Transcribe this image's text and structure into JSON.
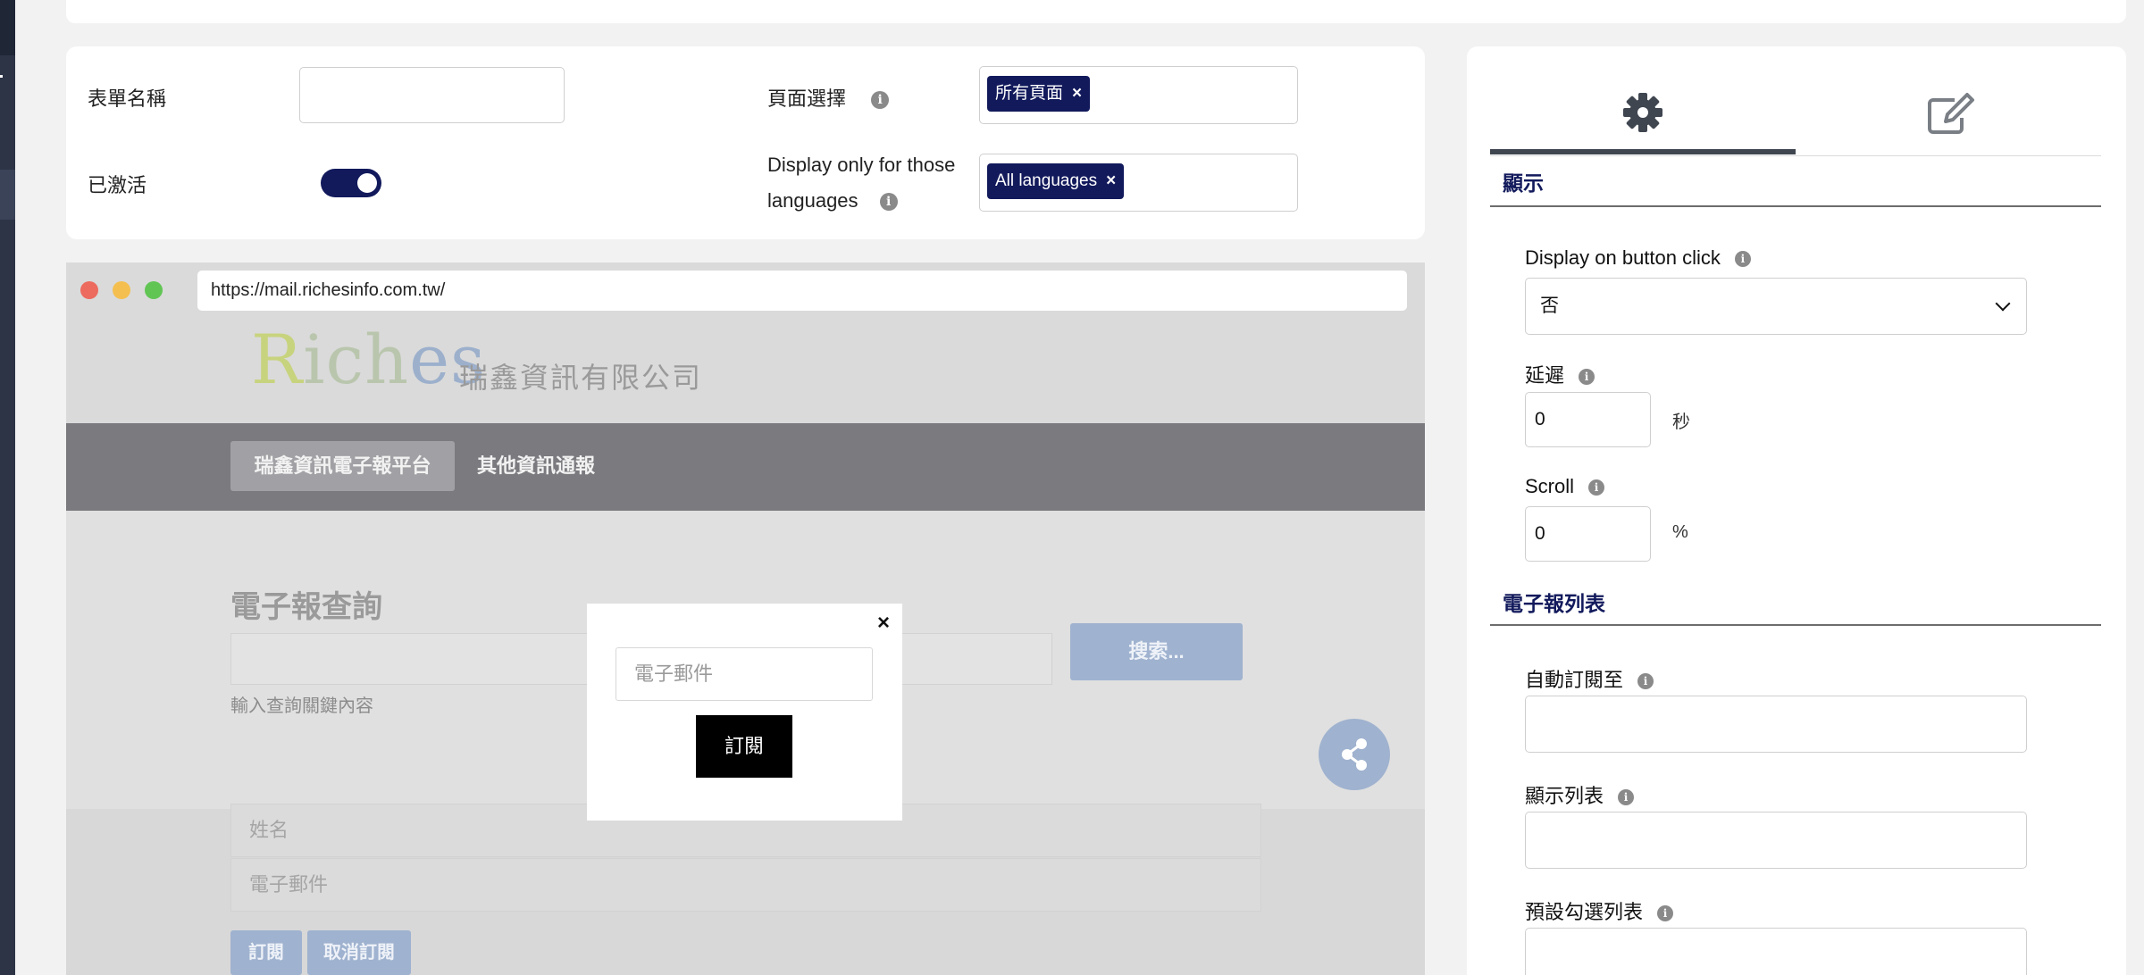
{
  "form": {
    "name_label": "表單名稱",
    "name_value": "",
    "active_label": "已激活",
    "active": true,
    "page_select_label": "頁面選擇",
    "page_tag": "所有頁面",
    "lang_label_line1": "Display only for those",
    "lang_label_line2": "languages",
    "lang_tag": "All languages",
    "tag_remove": "×"
  },
  "preview": {
    "url": "https://mail.richesinfo.com.tw/",
    "logo_r": "R",
    "logo_ich": "ich",
    "logo_es": "es",
    "logo_company": "瑞鑫資訊有限公司",
    "nav_active": "瑞鑫資訊電子報平台",
    "nav_other": "其他資訊通報",
    "section_title": "電子報查詢",
    "search_button": "搜索...",
    "search_hint": "輸入查詢關鍵內容",
    "name_placeholder": "姓名",
    "email_placeholder": "電子郵件",
    "subscribe_button": "訂閱",
    "unsubscribe_button": "取消訂閱"
  },
  "popup": {
    "close": "×",
    "email_placeholder": "電子郵件",
    "subscribe_button": "訂閱"
  },
  "panel": {
    "display_heading": "顯示",
    "button_click_label": "Display on button click",
    "button_click_value": "否",
    "delay_label": "延遲",
    "delay_value": "0",
    "delay_unit": "秒",
    "scroll_label": "Scroll",
    "scroll_value": "0",
    "scroll_unit": "%",
    "newsletter_heading": "電子報列表",
    "auto_subscribe_label": "自動訂閱至",
    "show_list_label": "顯示列表",
    "default_checked_label": "預設勾選列表"
  },
  "colors": {
    "navy": "#121a5c",
    "popup_button": "#000000",
    "site_accent": "#9fb2cf"
  },
  "icons": {
    "info": "i",
    "settings_tab": "gear-icon",
    "edit_tab": "edit-icon",
    "share": "share-icon"
  }
}
